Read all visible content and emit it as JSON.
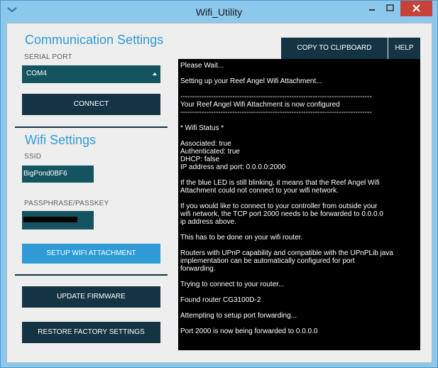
{
  "window": {
    "title": "Wifi_Utility"
  },
  "communication": {
    "heading": "Communication Settings",
    "serial_port_label": "SERIAL PORT",
    "serial_port_value": "COM4",
    "connect_label": "CONNECT"
  },
  "wifi": {
    "heading": "Wifi Settings",
    "ssid_label": "SSID",
    "ssid_value": "BigPond0BF6",
    "passphrase_label": "PASSPHRASE/PASSKEY",
    "setup_label": "SETUP WIFI ATTACHMENT"
  },
  "actions": {
    "update_firmware_label": "UPDATE FIRMWARE",
    "restore_label": "RESTORE FACTORY SETTINGS"
  },
  "toolbar": {
    "copy_label": "COPY TO CLIPBOARD",
    "help_label": "HELP"
  },
  "console": {
    "text": "Please Wait...\n\nSetting up your Reef Angel Wifi Attachment...\n\n---------------------------------------------------------------------------------\nYour Reef Angel Wifi Attachment is now configured\n---------------------------------------------------------------------------------\n\n* Wifi Status *\n\nAssociated: true\nAuthenticated: true\nDHCP: false\nIP address and port: 0.0.0.0:2000\n\nIf the blue LED is still blinking, it means that the Reef Angel Wifi\nAttachment could not connect to your wifi network.\n\nIf you would like to connect to your controller from outside your\nwifi network, the TCP port 2000 needs to be forwarded to 0.0.0.0\nip address above.\n\nThis has to be done on your wifi router.\n\nRouters with UPnP capability and compatible with the UPnPLib java\nimplementation can be automatically configured for port\nforwarding.\n\nTrying to connect to your router...\n\nFound router CG3100D-2\n\nAttempting to setup port forwarding...\n\nPort 2000 is now being forwarded to 0.0.0.0"
  },
  "colors": {
    "accent": "#2e9bd6",
    "dark_button": "#143443",
    "field_teal": "#135460",
    "close_button": "#c7413b"
  }
}
